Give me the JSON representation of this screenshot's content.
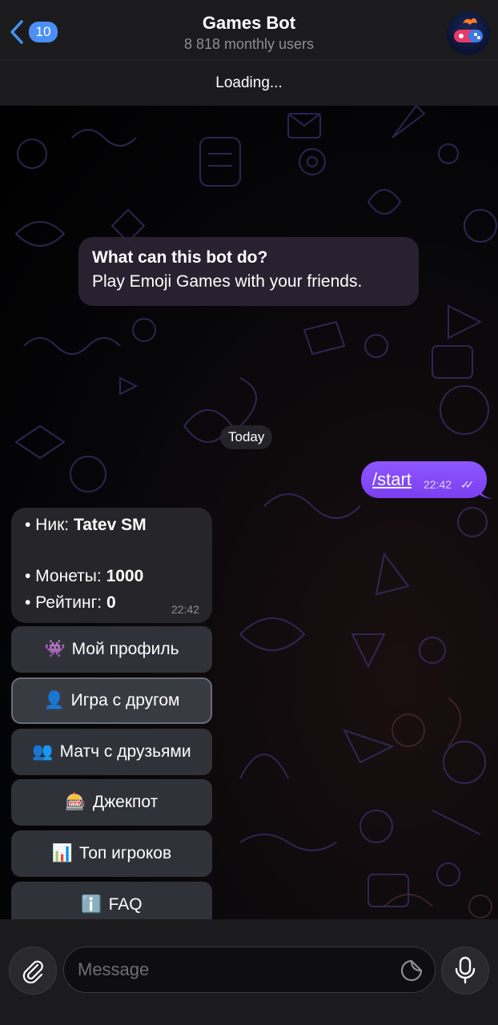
{
  "header": {
    "back_badge": "10",
    "title": "Games Bot",
    "subtitle": "8 818 monthly users",
    "status": "Loading..."
  },
  "info": {
    "title": "What can this bot do?",
    "text": "Play Emoji Games with your friends."
  },
  "date_chip": "Today",
  "outgoing": {
    "text": "/start",
    "time": "22:42",
    "checks": "✓✓"
  },
  "incoming": {
    "nick_label": "• Ник: ",
    "nick_value": "Tatev SM",
    "coins_label": "• Монеты: ",
    "coins_value": "1000",
    "rating_label": "• Рейтинг: ",
    "rating_value": "0",
    "time": "22:42"
  },
  "keyboard": [
    {
      "icon": "👾",
      "label": "Мой профиль"
    },
    {
      "icon": "👤",
      "label": "Игра с другом"
    },
    {
      "icon": "👥",
      "label": "Матч с друзьями"
    },
    {
      "icon": "🎰",
      "label": "Джекпот"
    },
    {
      "icon": "📊",
      "label": "Топ игроков"
    },
    {
      "icon": "ℹ️",
      "label": "FAQ"
    }
  ],
  "input": {
    "placeholder": "Message"
  },
  "colors": {
    "accent": "#4a8ff5",
    "outgoing": "#8e57ff"
  }
}
